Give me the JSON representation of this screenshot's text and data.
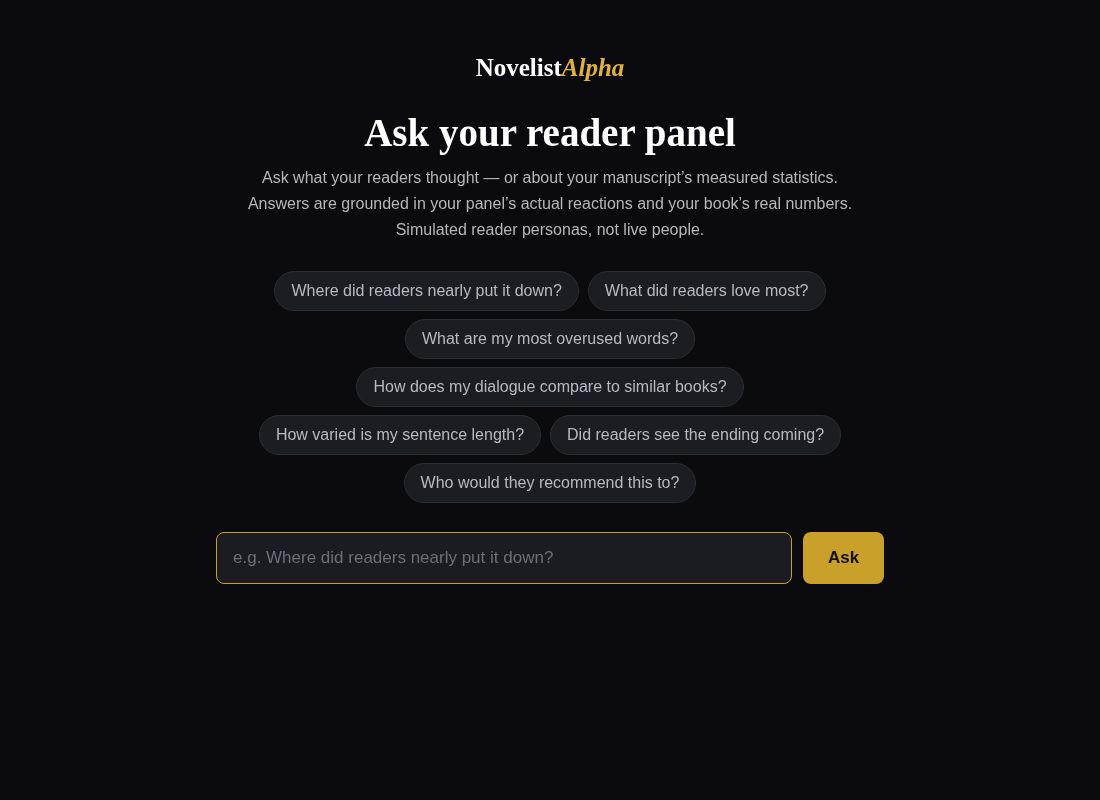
{
  "logo": {
    "text": "Novelist",
    "accent": "Alpha"
  },
  "title": "Ask your reader panel",
  "intro_lines": [
    "Ask what your readers thought — or about your manuscript’s measured statistics.",
    "Answers are grounded in your panel’s actual reactions and your book’s real numbers.",
    "Simulated reader personas, not live people."
  ],
  "suggestions": [
    "Where did readers nearly put it down?",
    "What did readers love most?",
    "What are my most overused words?",
    "How does my dialogue compare to similar books?",
    "How varied is my sentence length?",
    "Did readers see the ending coming?",
    "Who would they recommend this to?"
  ],
  "question_field": {
    "placeholder": "e.g. Where did readers nearly put it down?",
    "focused": true
  },
  "ask_button": "Ask"
}
